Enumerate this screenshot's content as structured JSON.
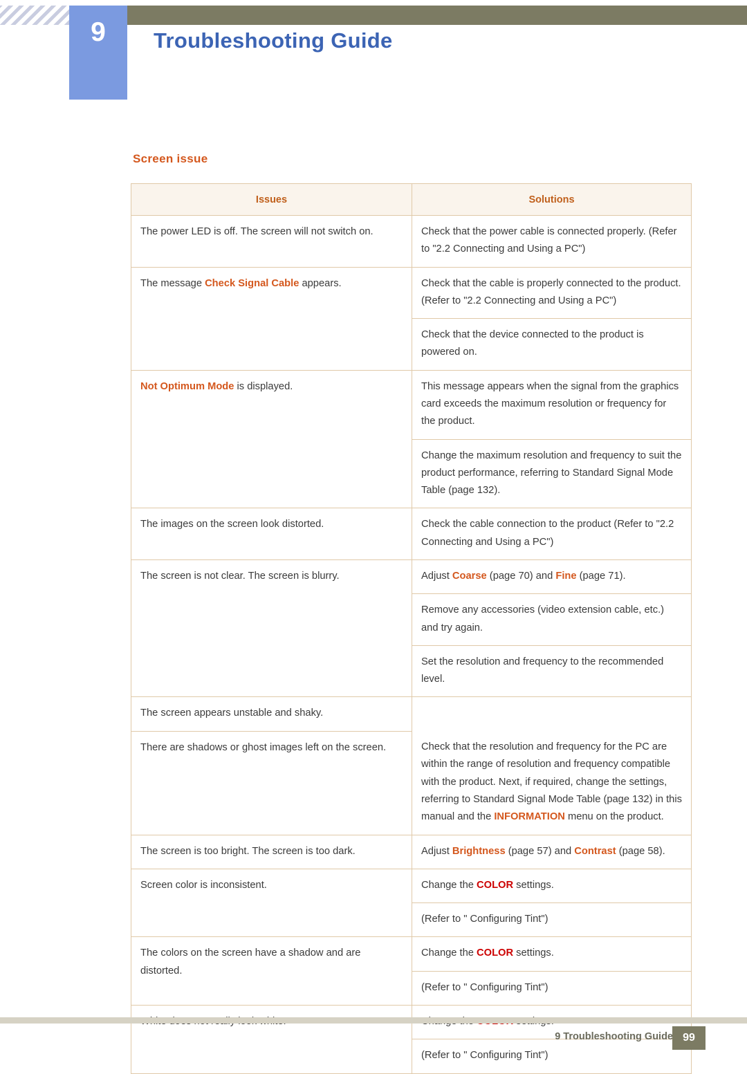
{
  "header": {
    "chapter_number": "9",
    "chapter_title": "Troubleshooting Guide"
  },
  "section": {
    "title": "Screen issue"
  },
  "table": {
    "columns": [
      "Issues",
      "Solutions"
    ],
    "rows": [
      {
        "issue_parts": [
          {
            "t": "The power LED is off. The screen will not switch on.",
            "style": "plain"
          }
        ],
        "solutions": [
          [
            {
              "t": "Check that the power cable is connected properly. (Refer to \"2.2 Connecting and Using a PC\")",
              "style": "plain"
            }
          ]
        ]
      },
      {
        "issue_parts": [
          {
            "t": "The message ",
            "style": "plain"
          },
          {
            "t": "Check Signal Cable",
            "style": "hl"
          },
          {
            "t": " appears.",
            "style": "plain"
          }
        ],
        "solutions": [
          [
            {
              "t": "Check that the cable is properly connected to the product. (Refer to \"2.2 Connecting and Using a PC\")",
              "style": "plain"
            }
          ],
          [
            {
              "t": "Check that the device connected to the product is powered on.",
              "style": "plain"
            }
          ]
        ]
      },
      {
        "issue_parts": [
          {
            "t": "Not Optimum Mode",
            "style": "hl"
          },
          {
            "t": " is displayed.",
            "style": "plain"
          }
        ],
        "solutions": [
          [
            {
              "t": "This message appears when the signal from the graphics card exceeds the maximum resolution or frequency for the product.",
              "style": "plain"
            }
          ],
          [
            {
              "t": "Change the maximum resolution and frequency to suit the product performance, referring to Standard Signal Mode Table (page 132).",
              "style": "plain"
            }
          ]
        ]
      },
      {
        "issue_parts": [
          {
            "t": "The images on the screen look distorted.",
            "style": "plain"
          }
        ],
        "solutions": [
          [
            {
              "t": "Check the cable connection to the product (Refer to \"2.2 Connecting and Using a PC\")",
              "style": "plain"
            }
          ]
        ]
      },
      {
        "issue_parts": [
          {
            "t": "The screen is not clear. The screen is blurry.",
            "style": "plain"
          }
        ],
        "solutions": [
          [
            {
              "t": "Adjust ",
              "style": "plain"
            },
            {
              "t": "Coarse",
              "style": "hl"
            },
            {
              "t": " (page 70) and ",
              "style": "plain"
            },
            {
              "t": "Fine",
              "style": "hl"
            },
            {
              "t": " (page 71).",
              "style": "plain"
            }
          ],
          [
            {
              "t": "Remove any accessories (video extension cable, etc.) and try again.",
              "style": "plain"
            }
          ],
          [
            {
              "t": "Set the resolution and frequency to the recommended level.",
              "style": "plain"
            }
          ]
        ]
      },
      {
        "issue_parts": [
          {
            "t": "The screen appears unstable and shaky.",
            "style": "plain"
          }
        ],
        "solutions": []
      },
      {
        "issue_parts": [
          {
            "t": "There are shadows or ghost images left on the screen.",
            "style": "plain"
          }
        ],
        "solutions": [
          [
            {
              "t": "Check that the resolution and frequency for the PC are within the range of resolution and frequency compatible with the product. Next, if required, change the settings, referring to Standard Signal Mode Table (page 132) in this manual and the ",
              "style": "plain"
            },
            {
              "t": "INFORMATION",
              "style": "hl"
            },
            {
              "t": " menu on the product.",
              "style": "plain"
            }
          ]
        ]
      },
      {
        "issue_parts": [
          {
            "t": "The screen is too bright. The screen is too dark.",
            "style": "plain"
          }
        ],
        "solutions": [
          [
            {
              "t": "Adjust ",
              "style": "plain"
            },
            {
              "t": "Brightness",
              "style": "hl"
            },
            {
              "t": " (page 57) and ",
              "style": "plain"
            },
            {
              "t": "Contrast",
              "style": "hl"
            },
            {
              "t": " (page 58).",
              "style": "plain"
            }
          ]
        ]
      },
      {
        "issue_parts": [
          {
            "t": "Screen color is inconsistent.",
            "style": "plain"
          }
        ],
        "solutions": [
          [
            {
              "t": "Change the ",
              "style": "plain"
            },
            {
              "t": "COLOR",
              "style": "hl-red"
            },
            {
              "t": " settings.",
              "style": "plain"
            }
          ],
          [
            {
              "t": "(Refer to \" Configuring Tint\")",
              "style": "plain"
            }
          ]
        ]
      },
      {
        "issue_parts": [
          {
            "t": "The colors on the screen have a shadow and are distorted.",
            "style": "plain"
          }
        ],
        "solutions": [
          [
            {
              "t": "Change the ",
              "style": "plain"
            },
            {
              "t": "COLOR",
              "style": "hl-red"
            },
            {
              "t": " settings.",
              "style": "plain"
            }
          ],
          [
            {
              "t": "(Refer to \" Configuring Tint\")",
              "style": "plain"
            }
          ]
        ]
      },
      {
        "issue_parts": [
          {
            "t": "White does not really look white.",
            "style": "plain"
          }
        ],
        "solutions": [
          [
            {
              "t": "Change the ",
              "style": "plain"
            },
            {
              "t": "COLOR",
              "style": "hl-red"
            },
            {
              "t": " settings.",
              "style": "plain"
            }
          ],
          [
            {
              "t": "(Refer to \" Configuring Tint\")",
              "style": "plain"
            }
          ]
        ]
      }
    ]
  },
  "footer": {
    "text": "9 Troubleshooting Guide",
    "page_number": "99"
  },
  "colors": {
    "accent_orange": "#d4581e",
    "accent_red": "#cc0000",
    "chapter_blue": "#3c64b4",
    "badge_blue": "#7b9ae0",
    "bar_olive": "#7c7b63",
    "table_border": "#e0c9a8",
    "table_header_bg": "#faf4ec"
  }
}
